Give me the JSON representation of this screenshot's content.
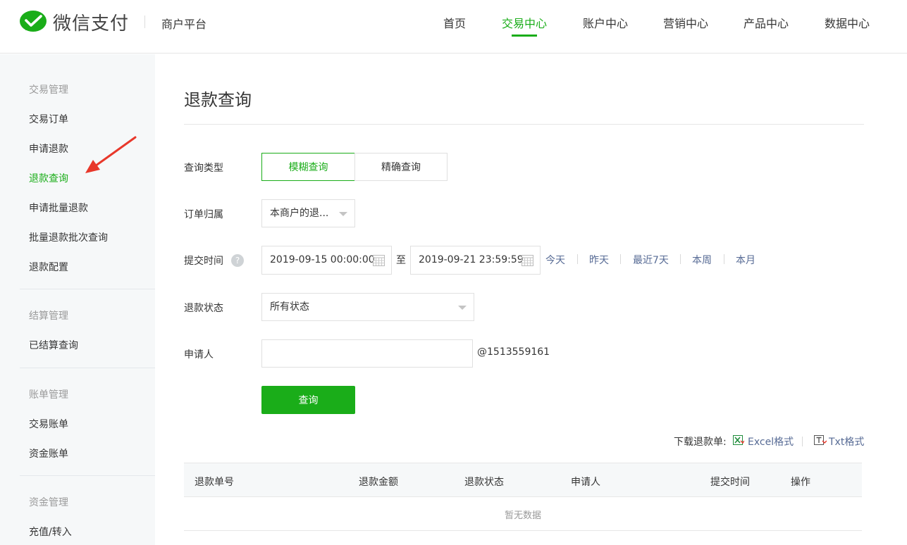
{
  "header": {
    "logo_text": "微信支付",
    "platform": "商户平台",
    "nav": [
      {
        "label": "首页"
      },
      {
        "label": "交易中心"
      },
      {
        "label": "账户中心"
      },
      {
        "label": "营销中心"
      },
      {
        "label": "产品中心"
      },
      {
        "label": "数据中心"
      }
    ],
    "active_nav": "交易中心"
  },
  "sidebar": {
    "groups": [
      {
        "title": "交易管理",
        "items": [
          "交易订单",
          "申请退款",
          "退款查询",
          "申请批量退款",
          "批量退款批次查询",
          "退款配置"
        ]
      },
      {
        "title": "结算管理",
        "items": [
          "已结算查询"
        ]
      },
      {
        "title": "账单管理",
        "items": [
          "交易账单",
          "资金账单"
        ]
      },
      {
        "title": "资金管理",
        "items": [
          "充值/转入"
        ]
      }
    ],
    "active_item": "退款查询"
  },
  "main": {
    "title": "退款查询",
    "query_type": {
      "label": "查询类型",
      "options": [
        "模糊查询",
        "精确查询"
      ],
      "selected": "模糊查询"
    },
    "order_owner": {
      "label": "订单归属",
      "value": "本商户的退..."
    },
    "submit_time": {
      "label": "提交时间",
      "help": "?",
      "start": "2019-09-15 00:00:00",
      "to": "至",
      "end": "2019-09-21 23:59:59",
      "quick": [
        "今天",
        "昨天",
        "最近7天",
        "本周",
        "本月"
      ]
    },
    "refund_status": {
      "label": "退款状态",
      "value": "所有状态"
    },
    "applicant": {
      "label": "申请人",
      "value": "",
      "suffix": "@1513559161"
    },
    "search_button": "查询",
    "download": {
      "label": "下载退款单:",
      "excel": "Excel格式",
      "txt": "Txt格式"
    },
    "table": {
      "columns": [
        "退款单号",
        "退款金额",
        "退款状态",
        "申请人",
        "提交时间",
        "操作"
      ],
      "empty": "暂无数据"
    }
  },
  "colors": {
    "accent": "#1aad19",
    "link": "#576b95",
    "arrow": "#e8382b"
  }
}
